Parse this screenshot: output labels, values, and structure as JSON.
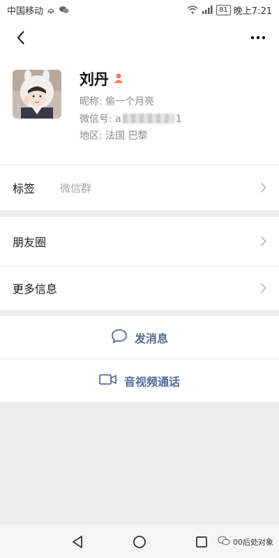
{
  "status_bar": {
    "carrier": "中国移动",
    "battery": "81",
    "time": "晚上7:21",
    "icons": [
      "notification-icon",
      "wechat-icon",
      "wifi-icon",
      "signal-icon",
      "battery-icon"
    ]
  },
  "nav": {
    "icons": [
      "back-icon",
      "more-icon"
    ]
  },
  "profile": {
    "name": "刘丹",
    "gender_icon": "person-icon",
    "nickname_label": "昵称:",
    "nickname": "偷一个月亮",
    "wxid_label": "微信号:",
    "wxid_start": "a",
    "wxid_end": "1",
    "region_label": "地区:",
    "region": "法国  巴黎"
  },
  "rows": {
    "tags_label": "标签",
    "tags_value": "微信群",
    "moments_label": "朋友圈",
    "more_label": "更多信息"
  },
  "actions": {
    "message": "发消息",
    "message_icon": "chat-bubble-icon",
    "call": "音视频通话",
    "call_icon": "video-camera-icon"
  },
  "system_nav": {
    "icons": [
      "back-triangle-icon",
      "home-circle-icon",
      "recents-square-icon"
    ]
  },
  "watermark": {
    "text": "00后处对象"
  },
  "colors": {
    "accent": "#576b95",
    "background": "#ededed",
    "gender_badge": "#f37b63"
  }
}
